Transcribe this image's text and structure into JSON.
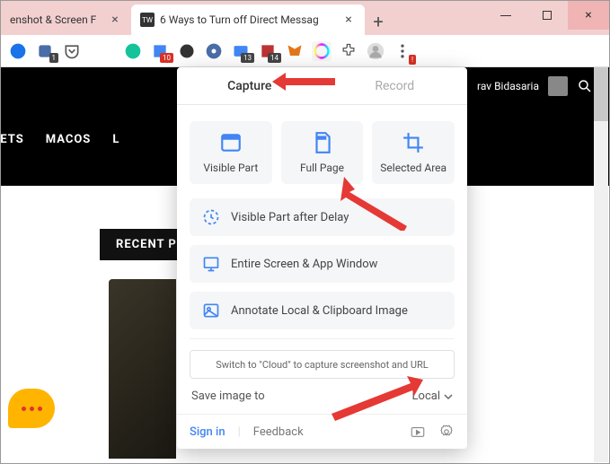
{
  "tabs": {
    "inactive": "enshot & Screen F",
    "activeFavicon": "TW",
    "active": "6 Ways to Turn off Direct Messag"
  },
  "toolbar": {
    "badges": {
      "b10": "10",
      "b13": "13",
      "b14": "14",
      "b1": "1"
    }
  },
  "page": {
    "nav": {
      "dgets": "DGETS",
      "macos": "MACOS",
      "l": "L"
    },
    "author": "rav Bidasaria",
    "recent": "RECENT PO"
  },
  "popup": {
    "tabs": {
      "capture": "Capture",
      "record": "Record"
    },
    "buttons": {
      "visiblePart": "Visible Part",
      "fullPage": "Full Page",
      "selectedArea": "Selected Area",
      "visibleDelay": "Visible Part after Delay",
      "entireScreen": "Entire Screen & App Window",
      "annotate": "Annotate Local & Clipboard Image"
    },
    "cloud": "Switch to \"Cloud\" to capture screenshot and URL",
    "saveLabel": "Save image to",
    "saveDest": "Local",
    "footer": {
      "signin": "Sign in",
      "feedback": "Feedback"
    }
  }
}
